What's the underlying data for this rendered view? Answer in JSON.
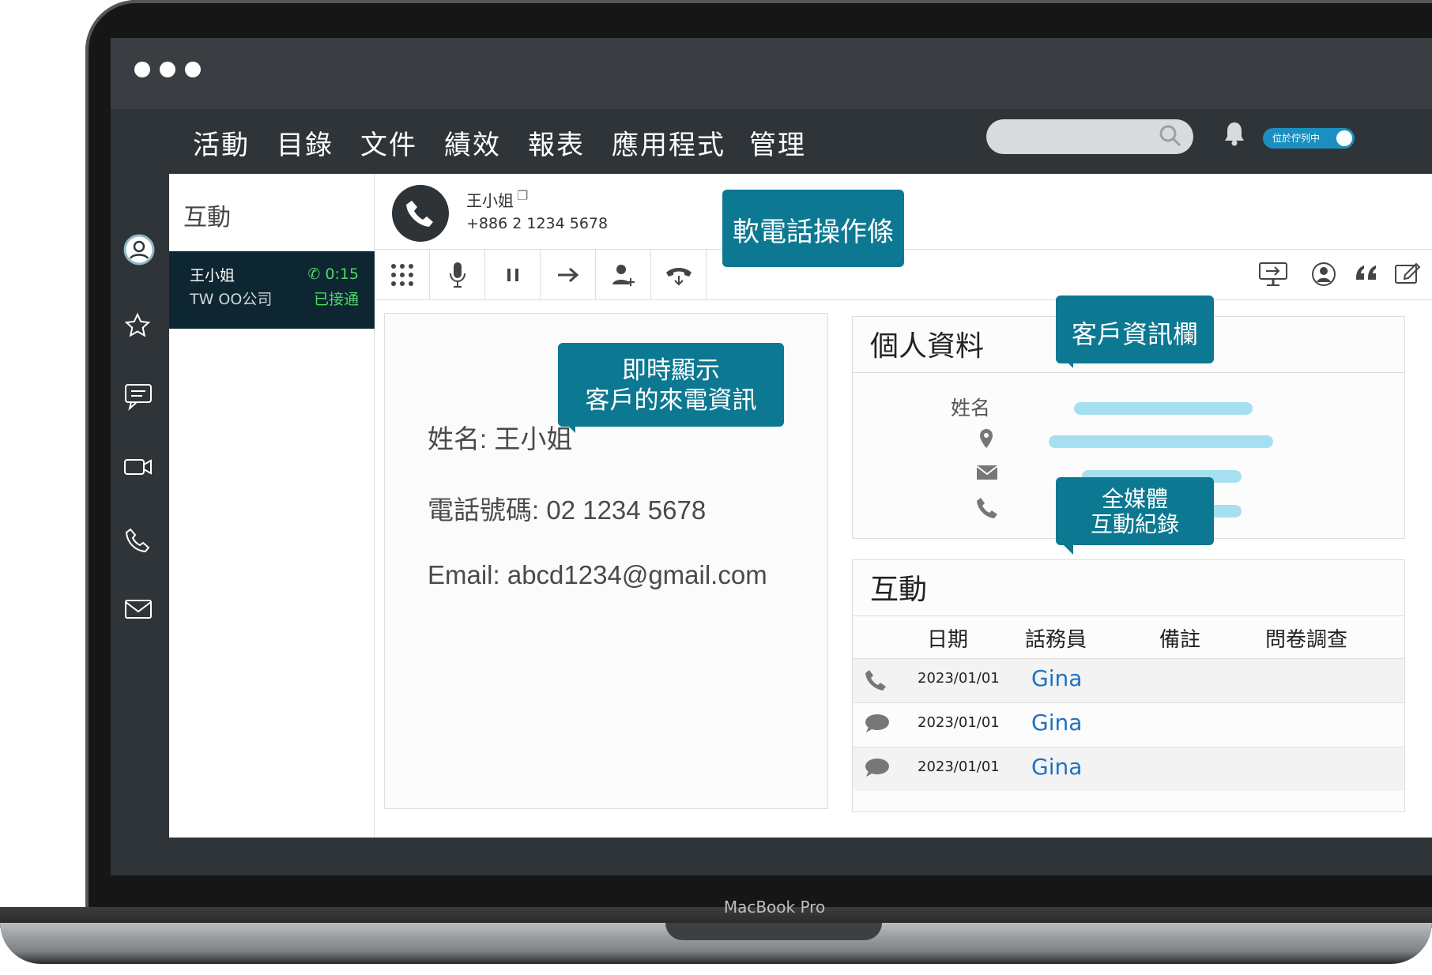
{
  "window": {
    "device_label": "MacBook Pro"
  },
  "nav": {
    "items": [
      "活動",
      "目錄",
      "文件",
      "績效",
      "報表",
      "應用程式",
      "管理"
    ],
    "status_toggle": "位於佇列中"
  },
  "left_panel": {
    "title": "互動",
    "active_call": {
      "name": "王小姐",
      "company": "TW OO公司",
      "duration": "0:15",
      "status": "已接通"
    }
  },
  "call_header": {
    "name": "王小姐",
    "number": "+886 2 1234 5678"
  },
  "caller_info": {
    "name_line": "姓名: 王小姐",
    "phone_line": "電話號碼: 02 1234 5678",
    "email_line": "Email:  abcd1234@gmail.com"
  },
  "profile": {
    "title": "個人資料",
    "name_label": "姓名"
  },
  "interactions": {
    "title": "互動",
    "columns": [
      "日期",
      "話務員",
      "備註",
      "問卷調查"
    ],
    "rows": [
      {
        "channel": "phone-icon",
        "date": "2023/01/01",
        "agent": "Gina"
      },
      {
        "channel": "chat-icon",
        "date": "2023/01/01",
        "agent": "Gina"
      },
      {
        "channel": "chat-icon",
        "date": "2023/01/01",
        "agent": "Gina"
      }
    ]
  },
  "callouts": {
    "softphone": "軟電話操作條",
    "realtime_line1": "即時顯示",
    "realtime_line2": "客戶的來電資訊",
    "customer_info": "客戶資訊欄",
    "omni_line1": "全媒體",
    "omni_line2": "互動紀錄"
  },
  "colors": {
    "accent": "#0d7891",
    "sidebar": "#2f3439",
    "bar": "#a6dff0",
    "link": "#1f72c0",
    "live": "#4cd964"
  }
}
